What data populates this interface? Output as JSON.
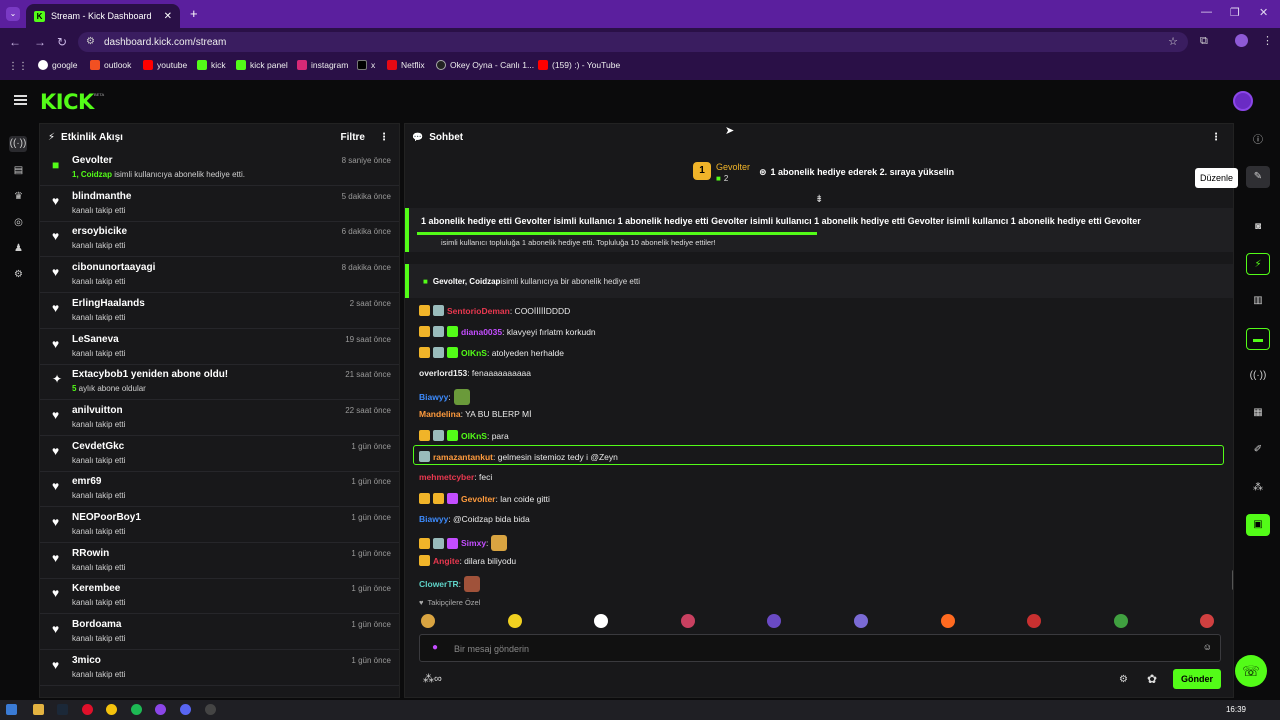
{
  "browser": {
    "tab_title": "Stream - Kick Dashboard",
    "url": "dashboard.kick.com/stream",
    "bookmarks": [
      "google",
      "outlook",
      "youtube",
      "kick",
      "kick panel",
      "instagram",
      "x",
      "Netflix",
      "Okey Oyna - Canlı 1...",
      "(159) :) - YouTube"
    ]
  },
  "app": {
    "logo": "KICK",
    "beta": "BETA"
  },
  "feed": {
    "title": "Etkinlik Akışı",
    "filter": "Filtre",
    "items": [
      {
        "icon": "gift-icon",
        "name": "Gevolter",
        "sub_hl": "1, Coidzap",
        "sub": " isimli kullanıcıya abonelik hediye etti.",
        "time": "8 saniye önce"
      },
      {
        "icon": "heart-icon",
        "name": "blindmanthe",
        "sub": "kanalı takip etti",
        "time": "5 dakika önce"
      },
      {
        "icon": "heart-icon",
        "name": "ersoybicike",
        "sub": "kanalı takip etti",
        "time": "6 dakika önce"
      },
      {
        "icon": "heart-icon",
        "name": "cibonunortaayagi",
        "sub": "kanalı takip etti",
        "time": "8 dakika önce"
      },
      {
        "icon": "heart-icon",
        "name": "ErlingHaalands",
        "sub": "kanalı takip etti",
        "time": "2 saat önce"
      },
      {
        "icon": "heart-icon",
        "name": "LeSaneva",
        "sub": "kanalı takip etti",
        "time": "19 saat önce"
      },
      {
        "icon": "star-icon",
        "name": "Extacybob1 yeniden abone oldu!",
        "sub_hl": "5",
        "sub": " aylık abone oldular",
        "time": "21 saat önce"
      },
      {
        "icon": "heart-icon",
        "name": "anilvuitton",
        "sub": "kanalı takip etti",
        "time": "22 saat önce"
      },
      {
        "icon": "heart-icon",
        "name": "CevdetGkc",
        "sub": "kanalı takip etti",
        "time": "1 gün önce"
      },
      {
        "icon": "heart-icon",
        "name": "emr69",
        "sub": "kanalı takip etti",
        "time": "1 gün önce"
      },
      {
        "icon": "heart-icon",
        "name": "NEOPoorBoy1",
        "sub": "kanalı takip etti",
        "time": "1 gün önce"
      },
      {
        "icon": "heart-icon",
        "name": "RRowin",
        "sub": "kanalı takip etti",
        "time": "1 gün önce"
      },
      {
        "icon": "heart-icon",
        "name": "Kerembee",
        "sub": "kanalı takip etti",
        "time": "1 gün önce"
      },
      {
        "icon": "heart-icon",
        "name": "Bordoama",
        "sub": "kanalı takip etti",
        "time": "1 gün önce"
      },
      {
        "icon": "heart-icon",
        "name": "3mico",
        "sub": "kanalı takip etti",
        "time": "1 gün önce"
      }
    ]
  },
  "chat": {
    "title": "Sohbet",
    "leader": {
      "rank": "1",
      "name": "Gevolter",
      "count": "2",
      "text": "1 abonelik hediye ederek 2. sıraya yükselin"
    },
    "ticker": "1 abonelik hediye etti  Gevolter isimli kullanıcı 1 abonelik hediye etti  Gevolter isimli kullanıcı 1 abonelik hediye etti  Gevolter isimli kullanıcı 1 abonelik hediye etti  Gevolter",
    "ticker_sub": "isimli kullanıcı topluluğa 1 abonelik hediye etti. Topluluğa 10 abonelik hediye ettiler!",
    "gift_line": {
      "names": "Gevolter, Coidzap",
      "text": " isimli kullanıcıya bir abonelik hediye etti"
    },
    "messages": [
      {
        "user": "SentorioDeman",
        "color": "#e8384f",
        "text": ": COOİİİİİDDDD"
      },
      {
        "user": "diana0035",
        "color": "#c34dff",
        "text": ": klavyeyi fırlatm korkudn"
      },
      {
        "user": "OlKnS",
        "color": "#53fc18",
        "text": ": atolyeden herhalde"
      },
      {
        "user": "overlord153",
        "color": "#f0f0f0",
        "text": ": fenaaaaaaaaaa"
      },
      {
        "user": "Biawyy",
        "color": "#3d8bfd",
        "text": ":"
      },
      {
        "user": "Mandelina",
        "color": "#ff9b3d",
        "text": ": YA BU BLERP Mİ"
      },
      {
        "user": "OlKnS",
        "color": "#53fc18",
        "text": ": para"
      },
      {
        "user": "ramazantankut",
        "color": "#ff9b3d",
        "text": ": gelmesin istemioz tedy i @Zeyn"
      },
      {
        "user": "mehmetcyber",
        "color": "#e8384f",
        "text": ": feci"
      },
      {
        "user": "Gevolter",
        "color": "#ff9b3d",
        "text": ": lan coide gitti"
      },
      {
        "user": "Biawyy",
        "color": "#3d8bfd",
        "text": ": @Coidzap bida bida"
      },
      {
        "user": "Simxy",
        "color": "#c34dff",
        "text": ":"
      },
      {
        "user": "Angite",
        "color": "#e8384f",
        "text": ": dilara biliyodu"
      },
      {
        "user": "ClowerTR",
        "color": "#5fd3c8",
        "text": ":"
      }
    ],
    "followers_only": "Takipçilere Özel",
    "placeholder": "Bir mesaj gönderin",
    "send": "Gönder"
  },
  "tooltip": "Düzenle",
  "clock": "16:39"
}
